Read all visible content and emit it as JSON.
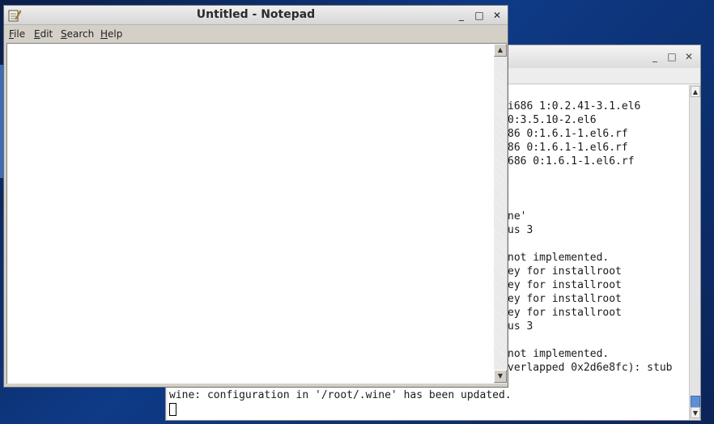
{
  "desktop": {
    "background_color": "#0e3a86"
  },
  "terminal": {
    "controls": {
      "minimize": "_",
      "maximize": "□",
      "close": "✕"
    },
    "lines": [
      "i686 1:0.2.41-3.1.el6",
      "0:3.5.10-2.el6",
      "86 0:1.6.1-1.el6.rf",
      "86 0:1.6.1-1.el6.rf",
      "686 0:1.6.1-1.el6.rf",
      "",
      "",
      "",
      "ne'",
      "us 3",
      "",
      "not implemented.",
      "ey for installroot",
      "ey for installroot",
      "ey for installroot",
      "ey for installroot",
      "us 3",
      "",
      "not implemented.",
      "verlapped 0x2d6e8fc): stub"
    ],
    "full_width_line": "wine: configuration in '/root/.wine' has been updated.",
    "scroll_up": "▲",
    "scroll_down": "▼"
  },
  "notepad": {
    "title": "Untitled - Notepad",
    "controls": {
      "minimize": "_",
      "maximize": "□",
      "close": "✕"
    },
    "menu": {
      "file": {
        "accel": "F",
        "rest": "ile"
      },
      "edit": {
        "accel": "E",
        "rest": "dit"
      },
      "search": {
        "accel": "S",
        "rest": "earch"
      },
      "help": {
        "accel": "H",
        "rest": "elp"
      }
    },
    "text": "",
    "scroll_up": "▲",
    "scroll_down": "▼"
  }
}
